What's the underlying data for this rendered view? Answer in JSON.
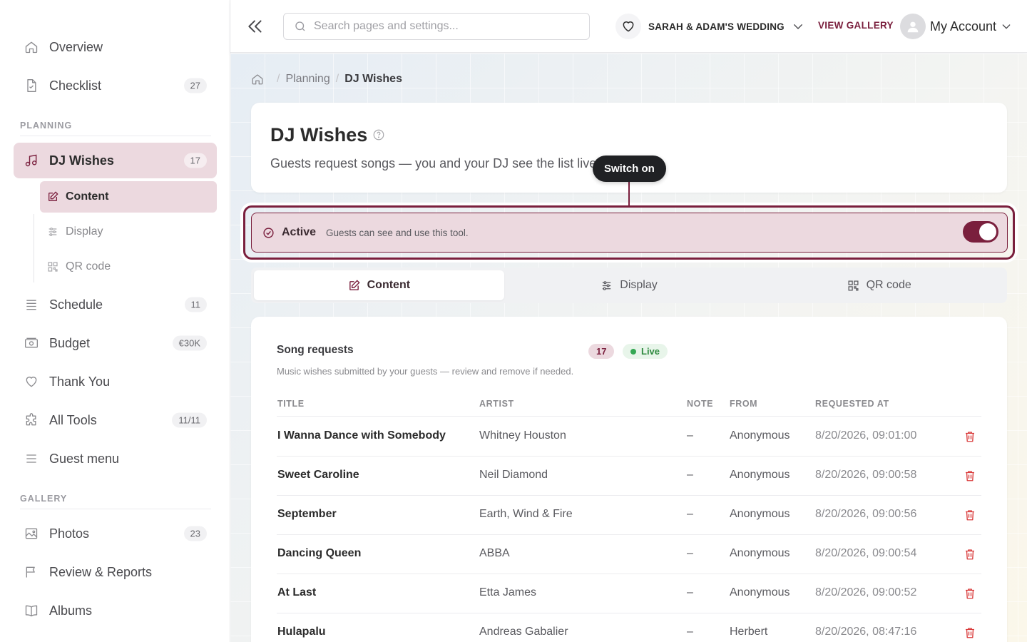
{
  "colors": {
    "accent": "#7a1f3d",
    "accent_soft": "#ecd9df",
    "live_green": "#34a853",
    "danger": "#d93a3a"
  },
  "sidebar": {
    "items_top": [
      {
        "label": "Overview",
        "icon": "home-icon"
      },
      {
        "label": "Checklist",
        "badge": "27",
        "icon": "file-check-icon"
      }
    ],
    "planning_label": "PLANNING",
    "dj": {
      "label": "DJ Wishes",
      "badge": "17",
      "icon": "music-icon"
    },
    "sub_items": [
      {
        "label": "Content",
        "icon": "edit-icon"
      },
      {
        "label": "Display",
        "icon": "sliders-icon"
      },
      {
        "label": "QR code",
        "icon": "qr-icon"
      }
    ],
    "items_mid": [
      {
        "label": "Schedule",
        "badge": "11",
        "icon": "list-icon"
      },
      {
        "label": "Budget",
        "badge": "€30K",
        "icon": "money-icon"
      },
      {
        "label": "Thank You",
        "icon": "heart-icon"
      },
      {
        "label": "All Tools",
        "badge": "11/11",
        "icon": "puzzle-icon"
      },
      {
        "label": "Guest menu",
        "icon": "menu-icon"
      }
    ],
    "gallery_label": "GALLERY",
    "items_gallery": [
      {
        "label": "Photos",
        "badge": "23",
        "icon": "image-icon"
      },
      {
        "label": "Review & Reports",
        "icon": "flag-icon"
      },
      {
        "label": "Albums",
        "icon": "book-icon"
      }
    ]
  },
  "topbar": {
    "search_placeholder": "Search pages and settings...",
    "wedding_name": "SARAH & ADAM'S WEDDING",
    "view_gallery": "VIEW GALLERY",
    "account": "My Account"
  },
  "breadcrumb": {
    "parent": "Planning",
    "current": "DJ Wishes"
  },
  "header": {
    "title": "DJ Wishes",
    "description": "Guests request songs — you and your DJ see the list live."
  },
  "tooltip": "Switch on",
  "active_bar": {
    "label": "Active",
    "sub": "Guests can see and use this tool.",
    "enabled": true
  },
  "tabs": [
    {
      "label": "Content",
      "icon": "edit-icon",
      "active": true
    },
    {
      "label": "Display",
      "icon": "sliders-icon",
      "active": false
    },
    {
      "label": "QR code",
      "icon": "qr-icon",
      "active": false
    }
  ],
  "songs": {
    "title": "Song requests",
    "count": "17",
    "live": "Live",
    "description": "Music wishes submitted by your guests — review and remove if needed.",
    "columns": [
      "TITLE",
      "ARTIST",
      "NOTE",
      "FROM",
      "REQUESTED AT"
    ],
    "rows": [
      {
        "title": "I Wanna Dance with Somebody",
        "artist": "Whitney Houston",
        "note": "–",
        "from": "Anonymous",
        "at": "8/20/2026, 09:01:00"
      },
      {
        "title": "Sweet Caroline",
        "artist": "Neil Diamond",
        "note": "–",
        "from": "Anonymous",
        "at": "8/20/2026, 09:00:58"
      },
      {
        "title": "September",
        "artist": "Earth, Wind & Fire",
        "note": "–",
        "from": "Anonymous",
        "at": "8/20/2026, 09:00:56"
      },
      {
        "title": "Dancing Queen",
        "artist": "ABBA",
        "note": "–",
        "from": "Anonymous",
        "at": "8/20/2026, 09:00:54"
      },
      {
        "title": "At Last",
        "artist": "Etta James",
        "note": "–",
        "from": "Anonymous",
        "at": "8/20/2026, 09:00:52"
      },
      {
        "title": "Hulapalu",
        "artist": "Andreas Gabalier",
        "note": "–",
        "from": "Herbert",
        "at": "8/20/2026, 08:47:16"
      }
    ]
  }
}
